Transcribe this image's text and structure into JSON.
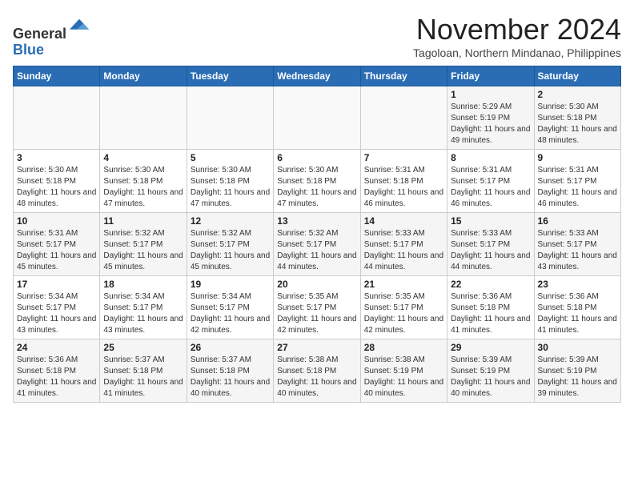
{
  "header": {
    "logo_general": "General",
    "logo_blue": "Blue",
    "month_title": "November 2024",
    "location": "Tagoloan, Northern Mindanao, Philippines"
  },
  "weekdays": [
    "Sunday",
    "Monday",
    "Tuesday",
    "Wednesday",
    "Thursday",
    "Friday",
    "Saturday"
  ],
  "weeks": [
    [
      {
        "day": "",
        "info": ""
      },
      {
        "day": "",
        "info": ""
      },
      {
        "day": "",
        "info": ""
      },
      {
        "day": "",
        "info": ""
      },
      {
        "day": "",
        "info": ""
      },
      {
        "day": "1",
        "info": "Sunrise: 5:29 AM\nSunset: 5:19 PM\nDaylight: 11 hours and 49 minutes."
      },
      {
        "day": "2",
        "info": "Sunrise: 5:30 AM\nSunset: 5:18 PM\nDaylight: 11 hours and 48 minutes."
      }
    ],
    [
      {
        "day": "3",
        "info": "Sunrise: 5:30 AM\nSunset: 5:18 PM\nDaylight: 11 hours and 48 minutes."
      },
      {
        "day": "4",
        "info": "Sunrise: 5:30 AM\nSunset: 5:18 PM\nDaylight: 11 hours and 47 minutes."
      },
      {
        "day": "5",
        "info": "Sunrise: 5:30 AM\nSunset: 5:18 PM\nDaylight: 11 hours and 47 minutes."
      },
      {
        "day": "6",
        "info": "Sunrise: 5:30 AM\nSunset: 5:18 PM\nDaylight: 11 hours and 47 minutes."
      },
      {
        "day": "7",
        "info": "Sunrise: 5:31 AM\nSunset: 5:18 PM\nDaylight: 11 hours and 46 minutes."
      },
      {
        "day": "8",
        "info": "Sunrise: 5:31 AM\nSunset: 5:17 PM\nDaylight: 11 hours and 46 minutes."
      },
      {
        "day": "9",
        "info": "Sunrise: 5:31 AM\nSunset: 5:17 PM\nDaylight: 11 hours and 46 minutes."
      }
    ],
    [
      {
        "day": "10",
        "info": "Sunrise: 5:31 AM\nSunset: 5:17 PM\nDaylight: 11 hours and 45 minutes."
      },
      {
        "day": "11",
        "info": "Sunrise: 5:32 AM\nSunset: 5:17 PM\nDaylight: 11 hours and 45 minutes."
      },
      {
        "day": "12",
        "info": "Sunrise: 5:32 AM\nSunset: 5:17 PM\nDaylight: 11 hours and 45 minutes."
      },
      {
        "day": "13",
        "info": "Sunrise: 5:32 AM\nSunset: 5:17 PM\nDaylight: 11 hours and 44 minutes."
      },
      {
        "day": "14",
        "info": "Sunrise: 5:33 AM\nSunset: 5:17 PM\nDaylight: 11 hours and 44 minutes."
      },
      {
        "day": "15",
        "info": "Sunrise: 5:33 AM\nSunset: 5:17 PM\nDaylight: 11 hours and 44 minutes."
      },
      {
        "day": "16",
        "info": "Sunrise: 5:33 AM\nSunset: 5:17 PM\nDaylight: 11 hours and 43 minutes."
      }
    ],
    [
      {
        "day": "17",
        "info": "Sunrise: 5:34 AM\nSunset: 5:17 PM\nDaylight: 11 hours and 43 minutes."
      },
      {
        "day": "18",
        "info": "Sunrise: 5:34 AM\nSunset: 5:17 PM\nDaylight: 11 hours and 43 minutes."
      },
      {
        "day": "19",
        "info": "Sunrise: 5:34 AM\nSunset: 5:17 PM\nDaylight: 11 hours and 42 minutes."
      },
      {
        "day": "20",
        "info": "Sunrise: 5:35 AM\nSunset: 5:17 PM\nDaylight: 11 hours and 42 minutes."
      },
      {
        "day": "21",
        "info": "Sunrise: 5:35 AM\nSunset: 5:17 PM\nDaylight: 11 hours and 42 minutes."
      },
      {
        "day": "22",
        "info": "Sunrise: 5:36 AM\nSunset: 5:18 PM\nDaylight: 11 hours and 41 minutes."
      },
      {
        "day": "23",
        "info": "Sunrise: 5:36 AM\nSunset: 5:18 PM\nDaylight: 11 hours and 41 minutes."
      }
    ],
    [
      {
        "day": "24",
        "info": "Sunrise: 5:36 AM\nSunset: 5:18 PM\nDaylight: 11 hours and 41 minutes."
      },
      {
        "day": "25",
        "info": "Sunrise: 5:37 AM\nSunset: 5:18 PM\nDaylight: 11 hours and 41 minutes."
      },
      {
        "day": "26",
        "info": "Sunrise: 5:37 AM\nSunset: 5:18 PM\nDaylight: 11 hours and 40 minutes."
      },
      {
        "day": "27",
        "info": "Sunrise: 5:38 AM\nSunset: 5:18 PM\nDaylight: 11 hours and 40 minutes."
      },
      {
        "day": "28",
        "info": "Sunrise: 5:38 AM\nSunset: 5:19 PM\nDaylight: 11 hours and 40 minutes."
      },
      {
        "day": "29",
        "info": "Sunrise: 5:39 AM\nSunset: 5:19 PM\nDaylight: 11 hours and 40 minutes."
      },
      {
        "day": "30",
        "info": "Sunrise: 5:39 AM\nSunset: 5:19 PM\nDaylight: 11 hours and 39 minutes."
      }
    ]
  ]
}
